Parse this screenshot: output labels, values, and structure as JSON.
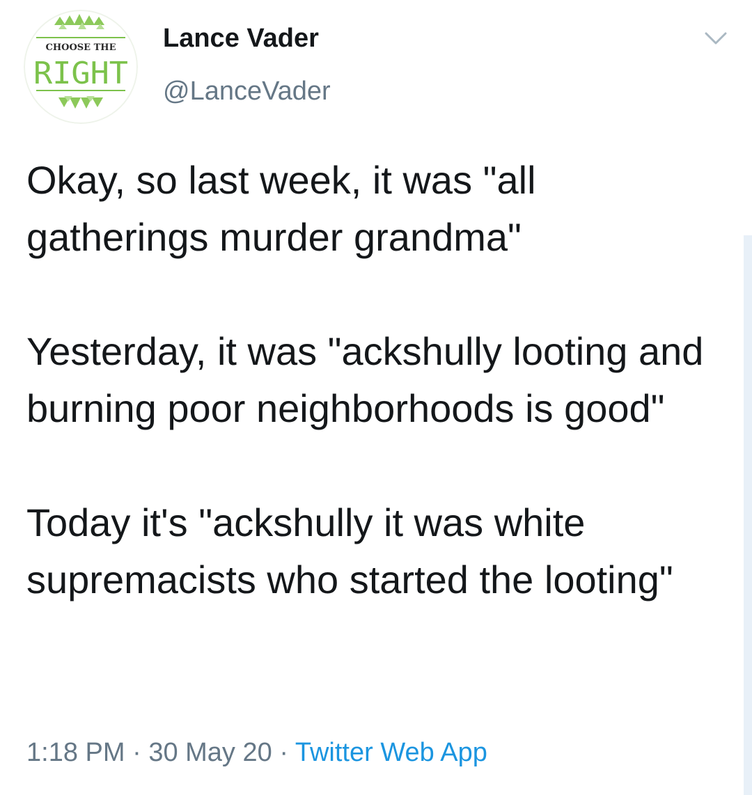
{
  "user": {
    "display_name": "Lance Vader",
    "handle": "@LanceVader",
    "avatar_text_top": "CHOOSE THE",
    "avatar_text_main": "RIGHT"
  },
  "tweet": {
    "paragraph_1": "Okay, so last week, it was \"all gatherings murder grandma\"",
    "paragraph_2": "Yesterday, it was \"ackshully looting and burning poor neighborhoods is good\"",
    "paragraph_3": "Today it's \"ackshully it was white supremacists who started the looting\""
  },
  "meta": {
    "time": "1:18 PM",
    "separator_1": " · ",
    "date": "30 May 20",
    "separator_2": " · ",
    "source": "Twitter Web App"
  },
  "icons": {
    "menu": "chevron-down-icon"
  },
  "colors": {
    "text_primary": "#14171a",
    "text_secondary": "#657786",
    "link": "#1b95e0",
    "avatar_green": "#7cc24b"
  }
}
